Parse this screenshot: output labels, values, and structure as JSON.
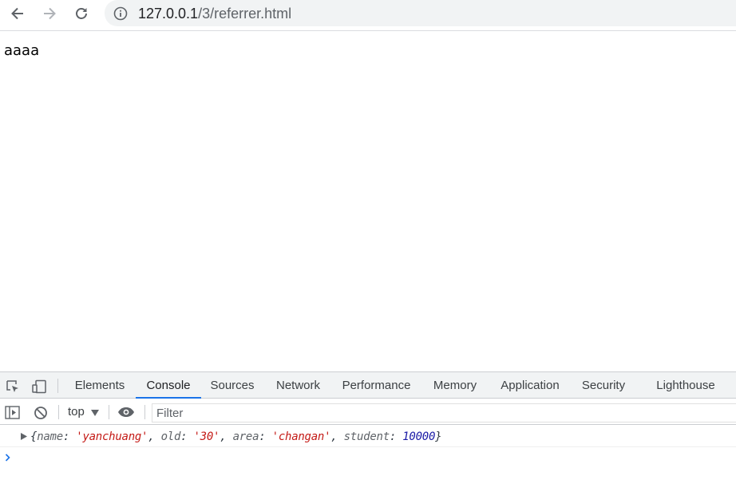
{
  "browser": {
    "url_host": "127.0.0.1",
    "url_path": "/3/referrer.html",
    "icons": {
      "back": "arrow-left-icon",
      "forward": "arrow-right-icon",
      "reload": "reload-icon",
      "site_info": "info-circle-icon"
    }
  },
  "page": {
    "text": "aaaa"
  },
  "devtools": {
    "tabs": [
      {
        "label": "Elements"
      },
      {
        "label": "Console",
        "active": true
      },
      {
        "label": "Sources"
      },
      {
        "label": "Network"
      },
      {
        "label": "Performance"
      },
      {
        "label": "Memory"
      },
      {
        "label": "Application"
      },
      {
        "label": "Security"
      },
      {
        "label": "Lighthouse"
      }
    ],
    "accent": "#1a73e8",
    "console_toolbar": {
      "context": "top",
      "filter_placeholder": "Filter",
      "filter_value": ""
    },
    "messages": [
      {
        "open": "{",
        "props": [
          {
            "key": "name",
            "sep": ": ",
            "value": "'yanchuang'",
            "kind": "string",
            "after": ", "
          },
          {
            "key": "old",
            "sep": ": ",
            "value": "'30'",
            "kind": "string",
            "after": ", "
          },
          {
            "key": "area",
            "sep": ": ",
            "value": "'changan'",
            "kind": "string",
            "after": ", "
          },
          {
            "key": "student",
            "sep": ": ",
            "value": "10000",
            "kind": "number",
            "after": ""
          }
        ],
        "close": "}"
      }
    ]
  }
}
